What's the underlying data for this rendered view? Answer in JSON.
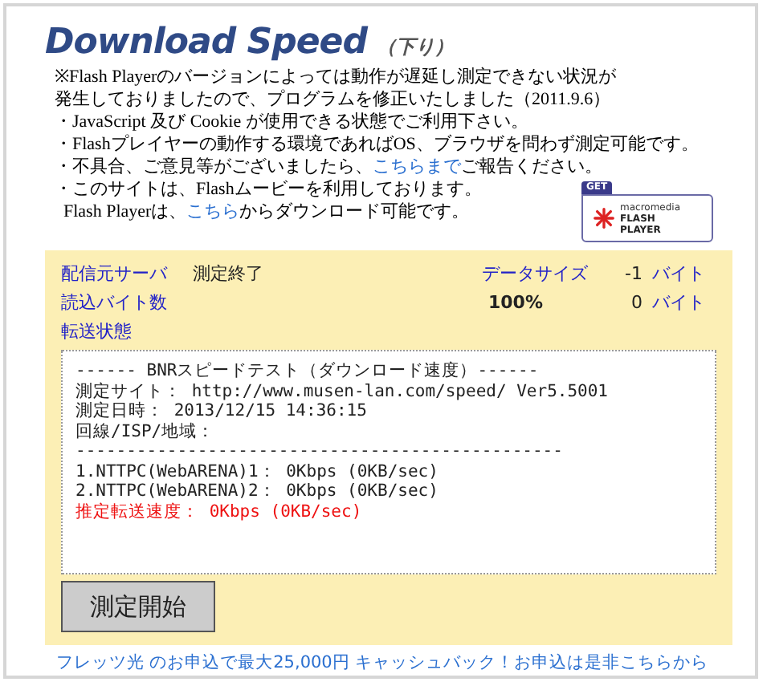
{
  "title": {
    "main": "Download Speed",
    "sub": "（下り）"
  },
  "notes": [
    {
      "parts": [
        {
          "kind": "text",
          "text": "※Flash Playerのバージョンによっては動作が遅延し測定できない状況が"
        }
      ]
    },
    {
      "parts": [
        {
          "kind": "text",
          "text": "発生しておりましたので、プログラムを修正いたしました（2011.9.6）"
        }
      ]
    },
    {
      "parts": [
        {
          "kind": "text",
          "text": "・JavaScript 及び Cookie が使用できる状態でご利用下さい。"
        }
      ]
    },
    {
      "parts": [
        {
          "kind": "text",
          "text": "・Flashプレイヤーの動作する環境であればOS、ブラウザを問わず測定可能です。"
        }
      ]
    },
    {
      "parts": [
        {
          "kind": "text",
          "text": "・不具合、ご意見等がございましたら、"
        },
        {
          "kind": "link",
          "text": "こちらまで"
        },
        {
          "kind": "text",
          "text": "ご報告ください。"
        }
      ]
    },
    {
      "parts": [
        {
          "kind": "text",
          "text": "・このサイトは、Flashムービーを利用しております。"
        }
      ]
    },
    {
      "parts": [
        {
          "kind": "text",
          "text": "  Flash Playerは、"
        },
        {
          "kind": "link",
          "text": "こちら"
        },
        {
          "kind": "text",
          "text": "からダウンロード可能です。"
        }
      ]
    }
  ],
  "flash_badge": {
    "tag": "GET",
    "brand": "macromedia",
    "product": [
      "FLASH",
      "PLAYER"
    ]
  },
  "panel": {
    "server_label": "配信元サーバ",
    "server_status": "測定終了",
    "size_label": "データサイズ",
    "size_value": "-1",
    "size_unit": "バイト",
    "read_label": "読込バイト数",
    "percent": "100%",
    "read_value": "0",
    "read_unit": "バイト",
    "transfer_label": "転送状態",
    "log": [
      {
        "kind": "normal",
        "text": "------ BNRスピードテスト（ダウンロード速度）------"
      },
      {
        "kind": "normal",
        "text": "測定サイト： http://www.musen-lan.com/speed/ Ver5.5001"
      },
      {
        "kind": "normal",
        "text": "測定日時： 2013/12/15 14:36:15"
      },
      {
        "kind": "normal",
        "text": "回線/ISP/地域："
      },
      {
        "kind": "normal",
        "text": "------------------------------------------------"
      },
      {
        "kind": "normal",
        "text": "1.NTTPC(WebARENA)1： 0Kbps (0KB/sec)"
      },
      {
        "kind": "normal",
        "text": "2.NTTPC(WebARENA)2： 0Kbps (0KB/sec)"
      },
      {
        "kind": "alert",
        "text": "推定転送速度： 0Kbps (0KB/sec)"
      }
    ],
    "start_button": "測定開始"
  },
  "footer_link": "フレッツ光 のお申込で最大25,000円 キャッシュバック！お申込は是非こちらから"
}
